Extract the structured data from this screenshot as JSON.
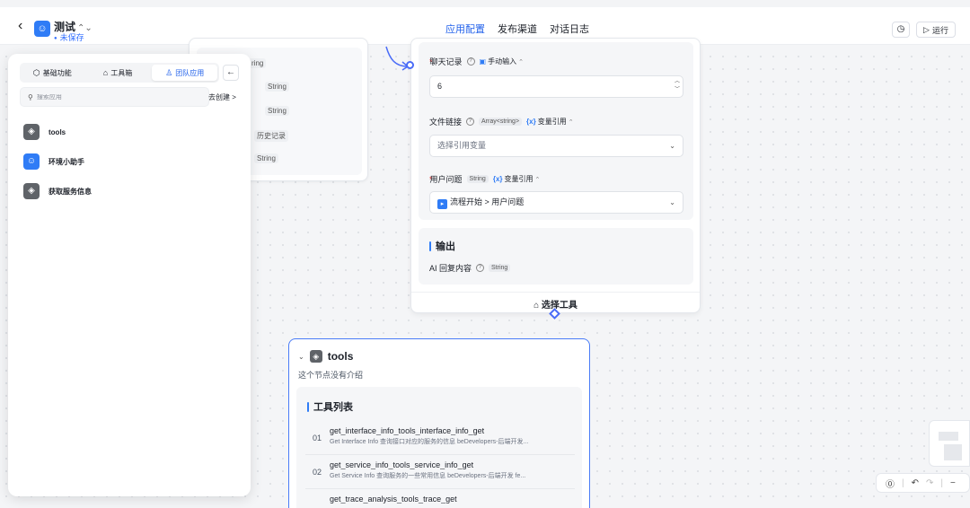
{
  "header": {
    "app_name": "测试",
    "app_name_switch": "⌃⌄",
    "status": "未保存",
    "nav": [
      "应用配置",
      "发布渠道",
      "对话日志"
    ],
    "run_label": "运行"
  },
  "left_node": {
    "tags": [
      "ring",
      "String",
      "String",
      "历史记录",
      "String"
    ]
  },
  "llm_node": {
    "chat_history": {
      "label": "聊天记录",
      "mode": "手动输入",
      "value": "6"
    },
    "file_link": {
      "label": "文件链接",
      "type": "Array<string>",
      "mode": "变量引用",
      "placeholder": "选择引用变量"
    },
    "user_question": {
      "label": "用户问题",
      "type": "String",
      "mode": "变量引用",
      "value": "流程开始 > 用户问题"
    },
    "output_title": "输出",
    "output_field": {
      "label": "AI 回复内容",
      "type": "String"
    },
    "select_tool": "选择工具"
  },
  "tools_node": {
    "name": "tools",
    "desc": "这个节点没有介绍",
    "list_title": "工具列表",
    "items": [
      {
        "num": "01",
        "name": "get_interface_info_tools_interface_info_get",
        "desc": "Get Interface Info 查询接口对应的服务的信息 beDevelopers-后端开发..."
      },
      {
        "num": "02",
        "name": "get_service_info_tools_service_info_get",
        "desc": "Get Service Info 查询服务的一些常用信息 beDevelopers-后端开发 fe..."
      },
      {
        "num": "",
        "name": "get_trace_analysis_tools_trace_get",
        "desc": ""
      }
    ]
  },
  "panel": {
    "tabs": [
      {
        "label": "基础功能",
        "icon": "cube-icon"
      },
      {
        "label": "工具箱",
        "icon": "toolbox-icon"
      },
      {
        "label": "团队应用",
        "icon": "user-icon"
      }
    ],
    "search_placeholder": "搜索应用",
    "goto_create": "去创建 >",
    "apps": [
      {
        "name": "tools",
        "icon": "tool-app-icon"
      },
      {
        "name": "环境小助手",
        "icon": "robot-app-icon"
      },
      {
        "name": "获取服务信息",
        "icon": "tool-app-icon"
      }
    ]
  },
  "colors": {
    "accent": "#2463eb",
    "node_border": "#4a7cf7",
    "required": "#e83030"
  }
}
